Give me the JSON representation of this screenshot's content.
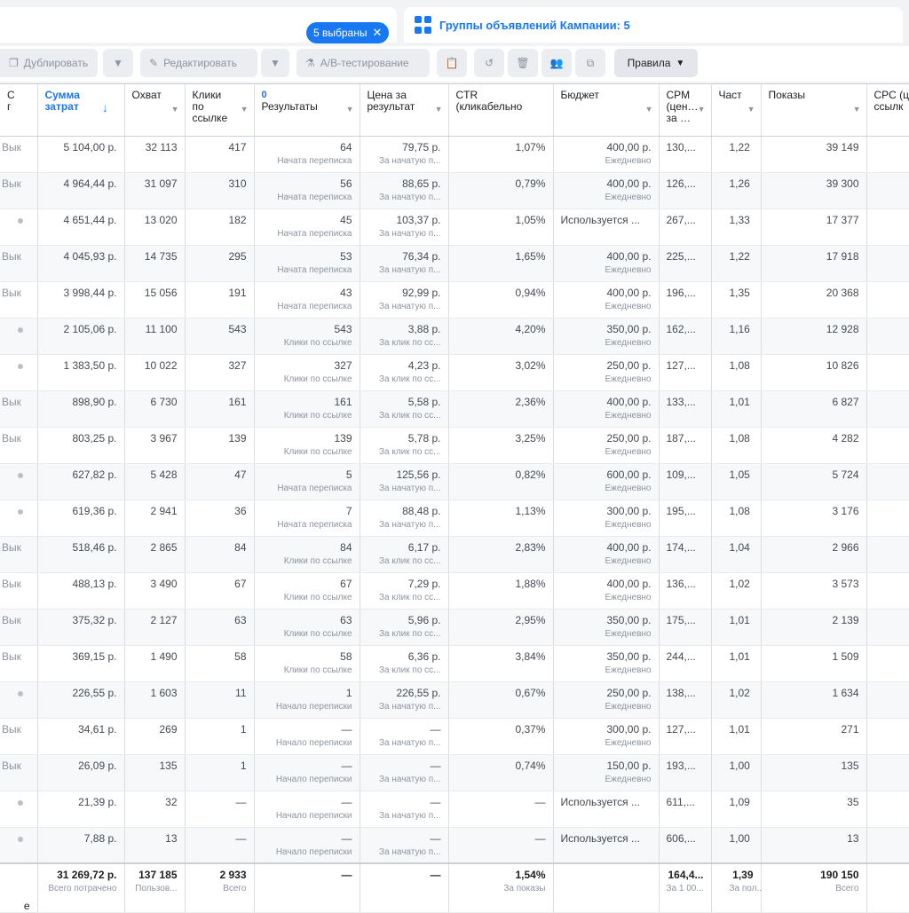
{
  "top": {
    "selected_label": "5 выбраны",
    "tab_label": "Группы объявлений Кампании: 5"
  },
  "toolbar": {
    "duplicate": "Дублировать",
    "edit": "Редактировать",
    "ab_test": "A/B-тестирование",
    "rules": "Правила"
  },
  "headers": {
    "status": "С\nг",
    "spend": "Сумма\nзатрат",
    "reach": "Охват",
    "clicks": "Клики\nпо\nссылке",
    "results_badge": "0",
    "results": "Результаты",
    "cpr": "Цена за\nрезультат",
    "ctr": "CTR\n(кликабельно",
    "budget": "Бюджет",
    "cpm": "CPM\n(цен…\nза …",
    "freq": "Част",
    "impressions": "Показы",
    "cpc": "CPC (ц\nссылк"
  },
  "rows": [
    {
      "status": "Вык",
      "spend": "5 104,00 р.",
      "reach": "32 113",
      "clicks": "417",
      "res": "64",
      "res_sub": "Начата переписка",
      "cpr": "79,75 р.",
      "cpr_sub": "За начатую п...",
      "ctr": "1,07%",
      "budget": "400,00 р.",
      "budget_sub": "Ежедневно",
      "cpm": "130,...",
      "freq": "1,22",
      "imp": "39 149"
    },
    {
      "status": "Вык",
      "spend": "4 964,44 р.",
      "reach": "31 097",
      "clicks": "310",
      "res": "56",
      "res_sub": "Начата переписка",
      "cpr": "88,65 р.",
      "cpr_sub": "За начатую п...",
      "ctr": "0,79%",
      "budget": "400,00 р.",
      "budget_sub": "Ежедневно",
      "cpm": "126,...",
      "freq": "1,26",
      "imp": "39 300"
    },
    {
      "status": "•",
      "spend": "4 651,44 р.",
      "reach": "13 020",
      "clicks": "182",
      "res": "45",
      "res_sub": "Начата переписка",
      "cpr": "103,37 р.",
      "cpr_sub": "За начатую п...",
      "ctr": "1,05%",
      "budget": "Используется ...",
      "budget_sub": "",
      "cpm": "267,...",
      "freq": "1,33",
      "imp": "17 377"
    },
    {
      "status": "Вык",
      "spend": "4 045,93 р.",
      "reach": "14 735",
      "clicks": "295",
      "res": "53",
      "res_sub": "Начата переписка",
      "cpr": "76,34 р.",
      "cpr_sub": "За начатую п...",
      "ctr": "1,65%",
      "budget": "400,00 р.",
      "budget_sub": "Ежедневно",
      "cpm": "225,...",
      "freq": "1,22",
      "imp": "17 918"
    },
    {
      "status": "Вык",
      "spend": "3 998,44 р.",
      "reach": "15 056",
      "clicks": "191",
      "res": "43",
      "res_sub": "Начата переписка",
      "cpr": "92,99 р.",
      "cpr_sub": "За начатую п...",
      "ctr": "0,94%",
      "budget": "400,00 р.",
      "budget_sub": "Ежедневно",
      "cpm": "196,...",
      "freq": "1,35",
      "imp": "20 368"
    },
    {
      "status": "•",
      "spend": "2 105,06 р.",
      "reach": "11 100",
      "clicks": "543",
      "res": "543",
      "res_sub": "Клики по ссылке",
      "cpr": "3,88 р.",
      "cpr_sub": "За клик по сс...",
      "ctr": "4,20%",
      "budget": "350,00 р.",
      "budget_sub": "Ежедневно",
      "cpm": "162,...",
      "freq": "1,16",
      "imp": "12 928"
    },
    {
      "status": "•",
      "spend": "1 383,50 р.",
      "reach": "10 022",
      "clicks": "327",
      "res": "327",
      "res_sub": "Клики по ссылке",
      "cpr": "4,23 р.",
      "cpr_sub": "За клик по сс...",
      "ctr": "3,02%",
      "budget": "250,00 р.",
      "budget_sub": "Ежедневно",
      "cpm": "127,...",
      "freq": "1,08",
      "imp": "10 826"
    },
    {
      "status": "Вык",
      "spend": "898,90 р.",
      "reach": "6 730",
      "clicks": "161",
      "res": "161",
      "res_sub": "Клики по ссылке",
      "cpr": "5,58 р.",
      "cpr_sub": "За клик по сс...",
      "ctr": "2,36%",
      "budget": "400,00 р.",
      "budget_sub": "Ежедневно",
      "cpm": "133,...",
      "freq": "1,01",
      "imp": "6 827"
    },
    {
      "status": "Вык",
      "spend": "803,25 р.",
      "reach": "3 967",
      "clicks": "139",
      "res": "139",
      "res_sub": "Клики по ссылке",
      "cpr": "5,78 р.",
      "cpr_sub": "За клик по сс...",
      "ctr": "3,25%",
      "budget": "250,00 р.",
      "budget_sub": "Ежедневно",
      "cpm": "187,...",
      "freq": "1,08",
      "imp": "4 282"
    },
    {
      "status": "•",
      "spend": "627,82 р.",
      "reach": "5 428",
      "clicks": "47",
      "res": "5",
      "res_sub": "Начата переписка",
      "cpr": "125,56 р.",
      "cpr_sub": "За начатую п...",
      "ctr": "0,82%",
      "budget": "600,00 р.",
      "budget_sub": "Ежедневно",
      "cpm": "109,...",
      "freq": "1,05",
      "imp": "5 724"
    },
    {
      "status": "•",
      "spend": "619,36 р.",
      "reach": "2 941",
      "clicks": "36",
      "res": "7",
      "res_sub": "Начата переписка",
      "cpr": "88,48 р.",
      "cpr_sub": "За начатую п...",
      "ctr": "1,13%",
      "budget": "300,00 р.",
      "budget_sub": "Ежедневно",
      "cpm": "195,...",
      "freq": "1,08",
      "imp": "3 176"
    },
    {
      "status": "Вык",
      "spend": "518,46 р.",
      "reach": "2 865",
      "clicks": "84",
      "res": "84",
      "res_sub": "Клики по ссылке",
      "cpr": "6,17 р.",
      "cpr_sub": "За клик по сс...",
      "ctr": "2,83%",
      "budget": "400,00 р.",
      "budget_sub": "Ежедневно",
      "cpm": "174,...",
      "freq": "1,04",
      "imp": "2 966"
    },
    {
      "status": "Вык",
      "spend": "488,13 р.",
      "reach": "3 490",
      "clicks": "67",
      "res": "67",
      "res_sub": "Клики по ссылке",
      "cpr": "7,29 р.",
      "cpr_sub": "За клик по сс...",
      "ctr": "1,88%",
      "budget": "400,00 р.",
      "budget_sub": "Ежедневно",
      "cpm": "136,...",
      "freq": "1,02",
      "imp": "3 573"
    },
    {
      "status": "Вык",
      "spend": "375,32 р.",
      "reach": "2 127",
      "clicks": "63",
      "res": "63",
      "res_sub": "Клики по ссылке",
      "cpr": "5,96 р.",
      "cpr_sub": "За клик по сс...",
      "ctr": "2,95%",
      "budget": "350,00 р.",
      "budget_sub": "Ежедневно",
      "cpm": "175,...",
      "freq": "1,01",
      "imp": "2 139"
    },
    {
      "status": "Вык",
      "spend": "369,15 р.",
      "reach": "1 490",
      "clicks": "58",
      "res": "58",
      "res_sub": "Клики по ссылке",
      "cpr": "6,36 р.",
      "cpr_sub": "За клик по сс...",
      "ctr": "3,84%",
      "budget": "350,00 р.",
      "budget_sub": "Ежедневно",
      "cpm": "244,...",
      "freq": "1,01",
      "imp": "1 509"
    },
    {
      "status": "•",
      "spend": "226,55 р.",
      "reach": "1 603",
      "clicks": "11",
      "res": "1",
      "res_sub": "Начало переписки",
      "cpr": "226,55 р.",
      "cpr_sub": "За начатую п...",
      "ctr": "0,67%",
      "budget": "250,00 р.",
      "budget_sub": "Ежедневно",
      "cpm": "138,...",
      "freq": "1,02",
      "imp": "1 634"
    },
    {
      "status": "Вык",
      "spend": "34,61 р.",
      "reach": "269",
      "clicks": "1",
      "res": "—",
      "res_sub": "Начало переписки",
      "cpr": "—",
      "cpr_sub": "За начатую п...",
      "ctr": "0,37%",
      "budget": "300,00 р.",
      "budget_sub": "Ежедневно",
      "cpm": "127,...",
      "freq": "1,01",
      "imp": "271"
    },
    {
      "status": "Вык",
      "spend": "26,09 р.",
      "reach": "135",
      "clicks": "1",
      "res": "—",
      "res_sub": "Начало переписки",
      "cpr": "—",
      "cpr_sub": "За начатую п...",
      "ctr": "0,74%",
      "budget": "150,00 р.",
      "budget_sub": "Ежедневно",
      "cpm": "193,...",
      "freq": "1,00",
      "imp": "135"
    },
    {
      "status": "•",
      "spend": "21,39 р.",
      "reach": "32",
      "clicks": "—",
      "res": "—",
      "res_sub": "Начало переписки",
      "cpr": "—",
      "cpr_sub": "За начатую п...",
      "ctr": "—",
      "budget": "Используется ...",
      "budget_sub": "",
      "cpm": "611,...",
      "freq": "1,09",
      "imp": "35"
    },
    {
      "status": "•",
      "spend": "7,88 р.",
      "reach": "13",
      "clicks": "—",
      "res": "—",
      "res_sub": "Начало переписки",
      "cpr": "—",
      "cpr_sub": "За начатую п...",
      "ctr": "—",
      "budget": "Используется ...",
      "budget_sub": "",
      "cpm": "606,...",
      "freq": "1,00",
      "imp": "13"
    }
  ],
  "totals": {
    "status": "е",
    "spend": "31 269,72 р.",
    "spend_sub": "Всего потрачено",
    "reach": "137 185",
    "reach_sub": "Пользов...",
    "clicks": "2 933",
    "clicks_sub": "Всего",
    "res": "—",
    "cpr": "—",
    "ctr": "1,54%",
    "ctr_sub": "За показы",
    "cpm": "164,4...",
    "cpm_sub": "За 1 00...",
    "freq": "1,39",
    "freq_sub": "За пол...",
    "imp": "190 150",
    "imp_sub": "Всего"
  }
}
